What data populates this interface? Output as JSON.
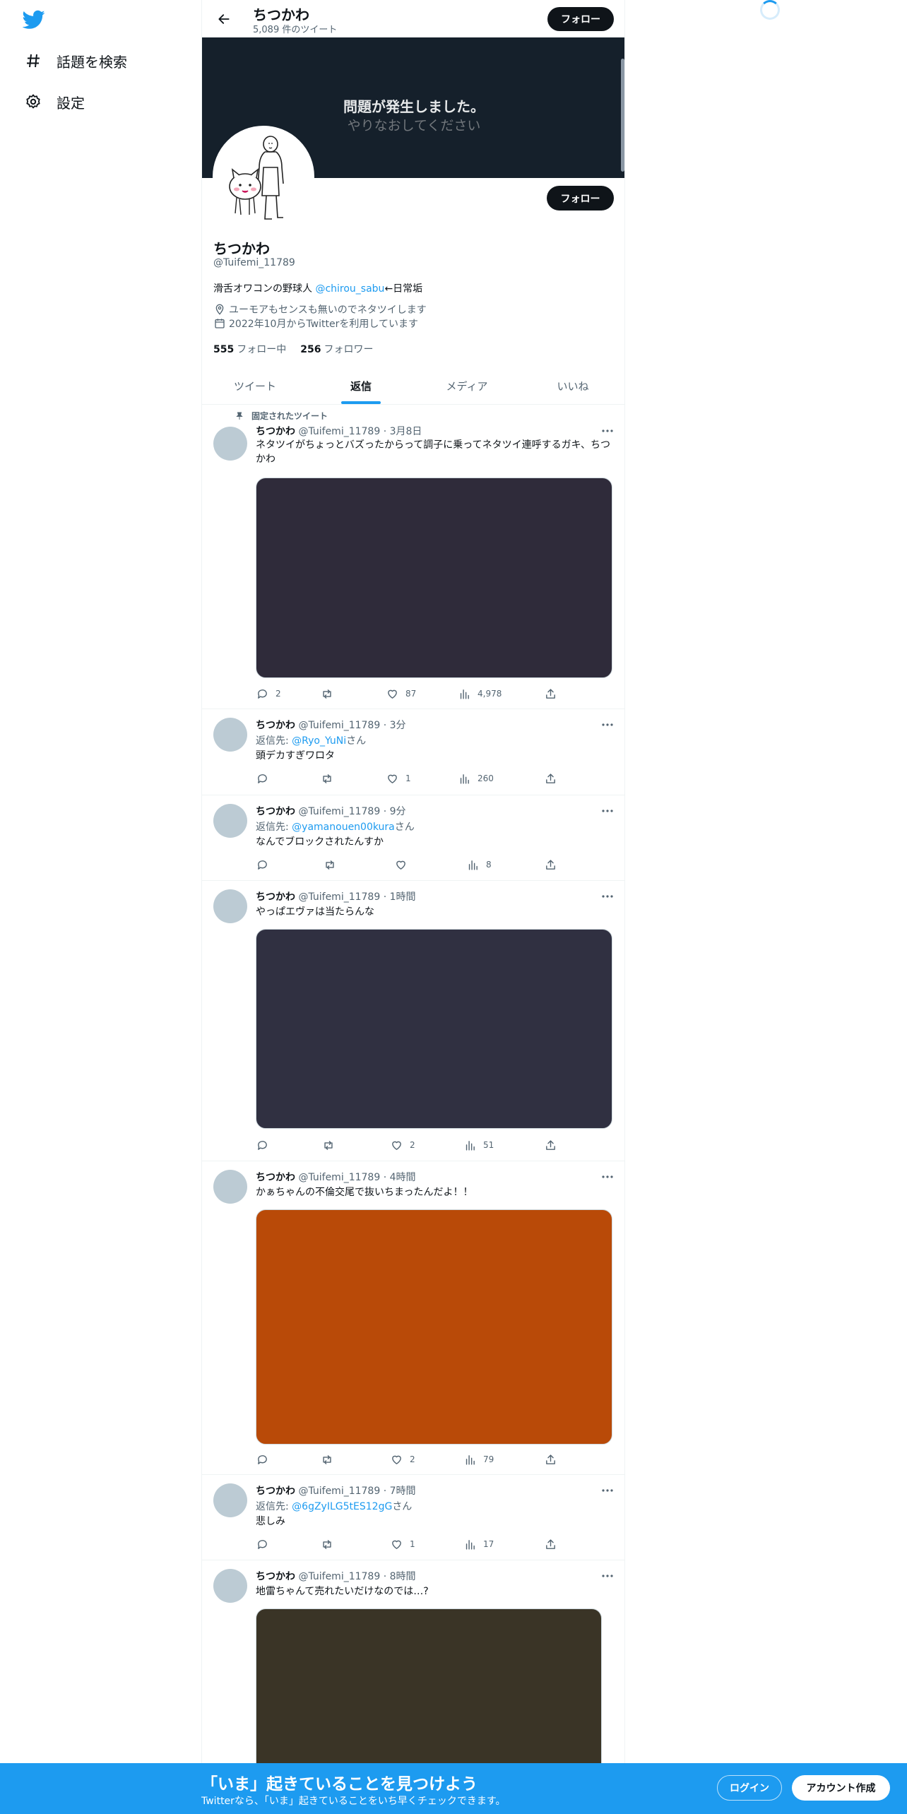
{
  "nav": {
    "explore_label": "話題を検索",
    "settings_label": "設定"
  },
  "header": {
    "title": "ちつかわ",
    "tweet_count": "5,089 件のツイート",
    "follow_label": "フォロー"
  },
  "banner": {
    "error_title": "問題が発生しました。",
    "error_sub": "やりなおしてください"
  },
  "profile": {
    "follow_label": "フォロー",
    "name": "ちつかわ",
    "handle": "@Tuifemi_11789",
    "bio_prefix": "滑舌オワコンの野球人 ",
    "bio_link": "@chirou_sabu",
    "bio_suffix": "←日常垢",
    "location": "ユーモアもセンスも無いのでネタツイします",
    "joined": "2022年10月からTwitterを利用しています",
    "following_count": "555",
    "following_label": "フォロー中",
    "followers_count": "256",
    "followers_label": "フォロワー"
  },
  "tabs": [
    "ツイート",
    "返信",
    "メディア",
    "いいね"
  ],
  "pinned_label": "固定されたツイート",
  "tweets": [
    {
      "name": "ちつかわ",
      "meta": "@Tuifemi_11789 · 3月8日",
      "text": "ネタツイがちょっとバズったからって調子に乗ってネタツイ連呼するガキ、ちつかわ",
      "media_color": "#2f2b3a",
      "replies": "2",
      "retweets": "",
      "likes": "87",
      "views": "4,978"
    },
    {
      "name": "ちつかわ",
      "meta": "@Tuifemi_11789 · 3分",
      "reply_prefix": "返信先: ",
      "reply_to": "@Ryo_YuNi",
      "reply_suffix": "さん",
      "text": "頭デカすぎワロタ",
      "replies": "",
      "retweets": "",
      "likes": "1",
      "views": "260"
    },
    {
      "name": "ちつかわ",
      "meta": "@Tuifemi_11789 · 9分",
      "reply_prefix": "返信先: ",
      "reply_to": "@yamanouen00kura",
      "reply_suffix": "さん",
      "text": "なんでブロックされたんすか",
      "replies": "",
      "retweets": "",
      "likes": "",
      "views": "8"
    },
    {
      "name": "ちつかわ",
      "meta": "@Tuifemi_11789 · 1時間",
      "text": "やっぱエヴァは当たらんな",
      "media_color": "#303041",
      "replies": "",
      "retweets": "",
      "likes": "2",
      "views": "51"
    },
    {
      "name": "ちつかわ",
      "meta": "@Tuifemi_11789 · 4時間",
      "text": "かぁちゃんの不倫交尾で抜いちまったんだよ！！",
      "media_color": "#b94a08",
      "replies": "",
      "retweets": "",
      "likes": "2",
      "views": "79"
    },
    {
      "name": "ちつかわ",
      "meta": "@Tuifemi_11789 · 7時間",
      "reply_prefix": "返信先: ",
      "reply_to": "@6gZyILG5tES12gG",
      "reply_suffix": "さん",
      "text": "悲しみ",
      "replies": "",
      "retweets": "",
      "likes": "1",
      "views": "17"
    },
    {
      "name": "ちつかわ",
      "meta": "@Tuifemi_11789 · 8時間",
      "text": "地雷ちゃんて売れたいだけなのでは…?",
      "media_color": "#3a3426"
    }
  ],
  "bottom_bar": {
    "title": "「いま」起きていることを見つけよう",
    "subtitle": "Twitterなら、「いま」起きていることをいち早くチェックできます。",
    "login_label": "ログイン",
    "signup_label": "アカウント作成"
  },
  "colors": {
    "accent": "#1d9bf0",
    "text_primary": "#0f1419",
    "text_secondary": "#536471",
    "banner_bg": "#15202b"
  }
}
